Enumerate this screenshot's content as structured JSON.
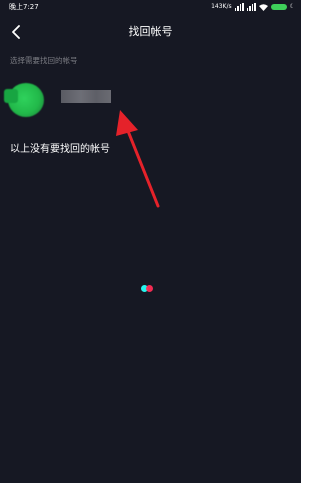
{
  "status_bar": {
    "time": "晚上7:27",
    "speed": "143K/s",
    "icons": [
      "signal-icon",
      "signal-icon",
      "wifi-icon",
      "battery-icon",
      "moon-icon"
    ]
  },
  "nav": {
    "back_icon": "chevron-left-icon",
    "title": "找回帐号"
  },
  "section_hint": "选择需要找回的帐号",
  "account": {
    "name": "",
    "avatar_color": "#2fd25c"
  },
  "not_listed_link": "以上没有要找回的帐号",
  "colors": {
    "background": "#161823",
    "arrow": "#e5222a",
    "loader_cyan": "#25f4ee",
    "loader_red": "#fe2c55"
  }
}
